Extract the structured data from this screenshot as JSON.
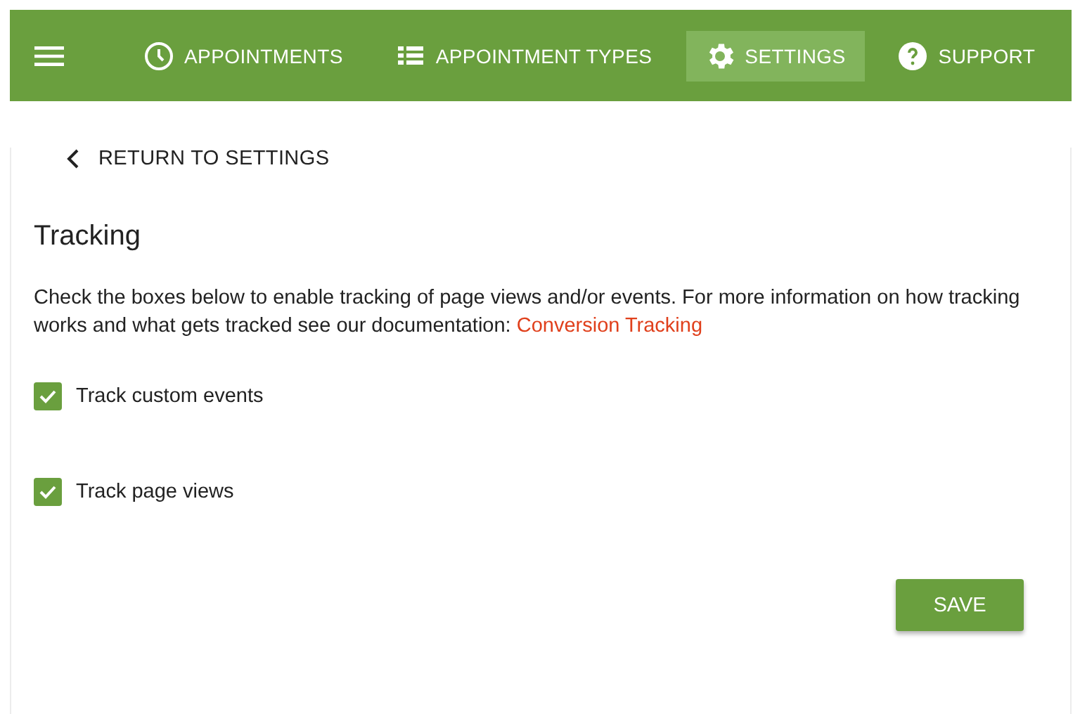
{
  "nav": {
    "tabs": [
      {
        "label": "APPOINTMENTS",
        "kind": "clock",
        "selected": false
      },
      {
        "label": "APPOINTMENT TYPES",
        "kind": "list",
        "selected": false
      },
      {
        "label": "SETTINGS",
        "kind": "gear",
        "selected": true
      },
      {
        "label": "SUPPORT",
        "kind": "help",
        "selected": false
      }
    ]
  },
  "back_link": "RETURN TO SETTINGS",
  "heading": "Tracking",
  "description": "Check the boxes below to enable tracking of page views and/or events. For more information on how tracking works and what gets tracked see our documentation: ",
  "doc_link": "Conversion Tracking",
  "options": [
    {
      "label": "Track custom events",
      "checked": true
    },
    {
      "label": "Track page views",
      "checked": true
    }
  ],
  "save_button": "SAVE"
}
